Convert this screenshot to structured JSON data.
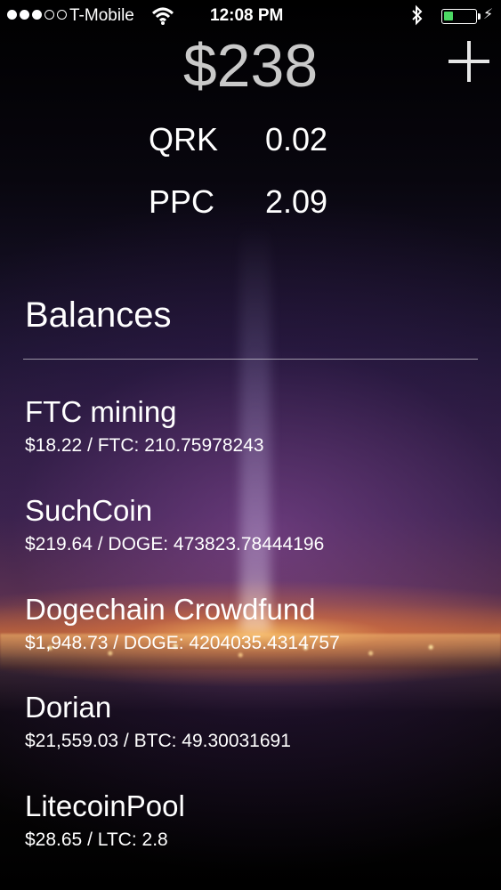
{
  "status_bar": {
    "signal_dots_filled": 3,
    "signal_dots_total": 5,
    "carrier": "T-Mobile",
    "time": "12:08 PM",
    "battery_level": 0.3,
    "battery_color": "#4cd964"
  },
  "header": {
    "total": "$238",
    "add_icon": "plus-icon"
  },
  "rates": [
    {
      "symbol": "QRK",
      "value": "0.02"
    },
    {
      "symbol": "PPC",
      "value": "2.09"
    }
  ],
  "balances": {
    "title": "Balances",
    "items": [
      {
        "name": "FTC mining",
        "detail": "$18.22 / FTC: 210.75978243"
      },
      {
        "name": "SuchCoin",
        "detail": "$219.64 / DOGE: 473823.78444196"
      },
      {
        "name": "Dogechain Crowdfund",
        "detail": "$1,948.73 / DOGE: 4204035.4314757"
      },
      {
        "name": "Dorian",
        "detail": "$21,559.03 / BTC: 49.30031691"
      },
      {
        "name": "LitecoinPool",
        "detail": "$28.65 / LTC: 2.8"
      }
    ]
  }
}
